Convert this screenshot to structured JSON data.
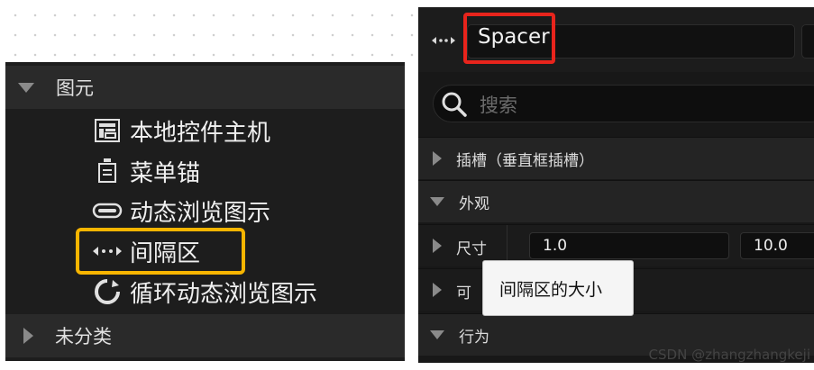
{
  "palette": {
    "category": {
      "label": "图元",
      "items": [
        {
          "label": "本地控件主机",
          "icon": "native-widget-host-icon"
        },
        {
          "label": "菜单锚",
          "icon": "menu-anchor-icon"
        },
        {
          "label": "动态浏览图示",
          "icon": "dynamic-entry-box-icon"
        },
        {
          "label": "间隔区",
          "icon": "spacer-icon"
        },
        {
          "label": "循环动态浏览图示",
          "icon": "throbber-icon"
        }
      ]
    },
    "collapsed_category": {
      "label": "未分类"
    }
  },
  "details": {
    "widget_name": "Spacer",
    "widget_icon": "spacer-icon",
    "search": {
      "placeholder": "搜索"
    },
    "sections": {
      "slot": "插槽（垂直框插槽）",
      "appearance": "外观",
      "behavior": "行为"
    },
    "size": {
      "label": "尺寸",
      "x": "1.0",
      "y": "10.0"
    },
    "partial_row": {
      "label": "可"
    },
    "tooltip": "间隔区的大小"
  },
  "watermark": "CSDN @zhangzhangkeji",
  "colors": {
    "highlight_yellow": "#f7b500",
    "highlight_red": "#e8241c"
  }
}
